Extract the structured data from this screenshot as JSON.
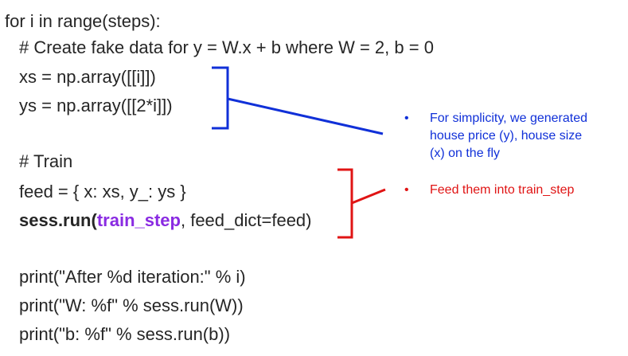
{
  "code": {
    "line1": "for i in range(steps):",
    "line2": "# Create fake data for y = W.x + b where W = 2, b = 0",
    "line3": "xs = np.array([[i]])",
    "line4": "ys = np.array([[2*i]])",
    "line5": "# Train",
    "line6": "feed = { x: xs, y_: ys }",
    "line7_fn": "sess.run(",
    "line7_arg": "train_step",
    "line7_rest": ", feed_dict=feed)",
    "line8": "print(\"After %d iteration:\" % i)",
    "line9": "print(\"W: %f\" % sess.run(W))",
    "line10": "print(\"b: %f\" % sess.run(b))"
  },
  "annotations": {
    "bullet": "•",
    "blue_note": "For simplicity, we generated house price (y), house size (x) on the fly",
    "red_note": "Feed them into train_step"
  },
  "colors": {
    "text": "#262626",
    "blue": "#1030d8",
    "red": "#e01414",
    "purple": "#8a2be2"
  }
}
